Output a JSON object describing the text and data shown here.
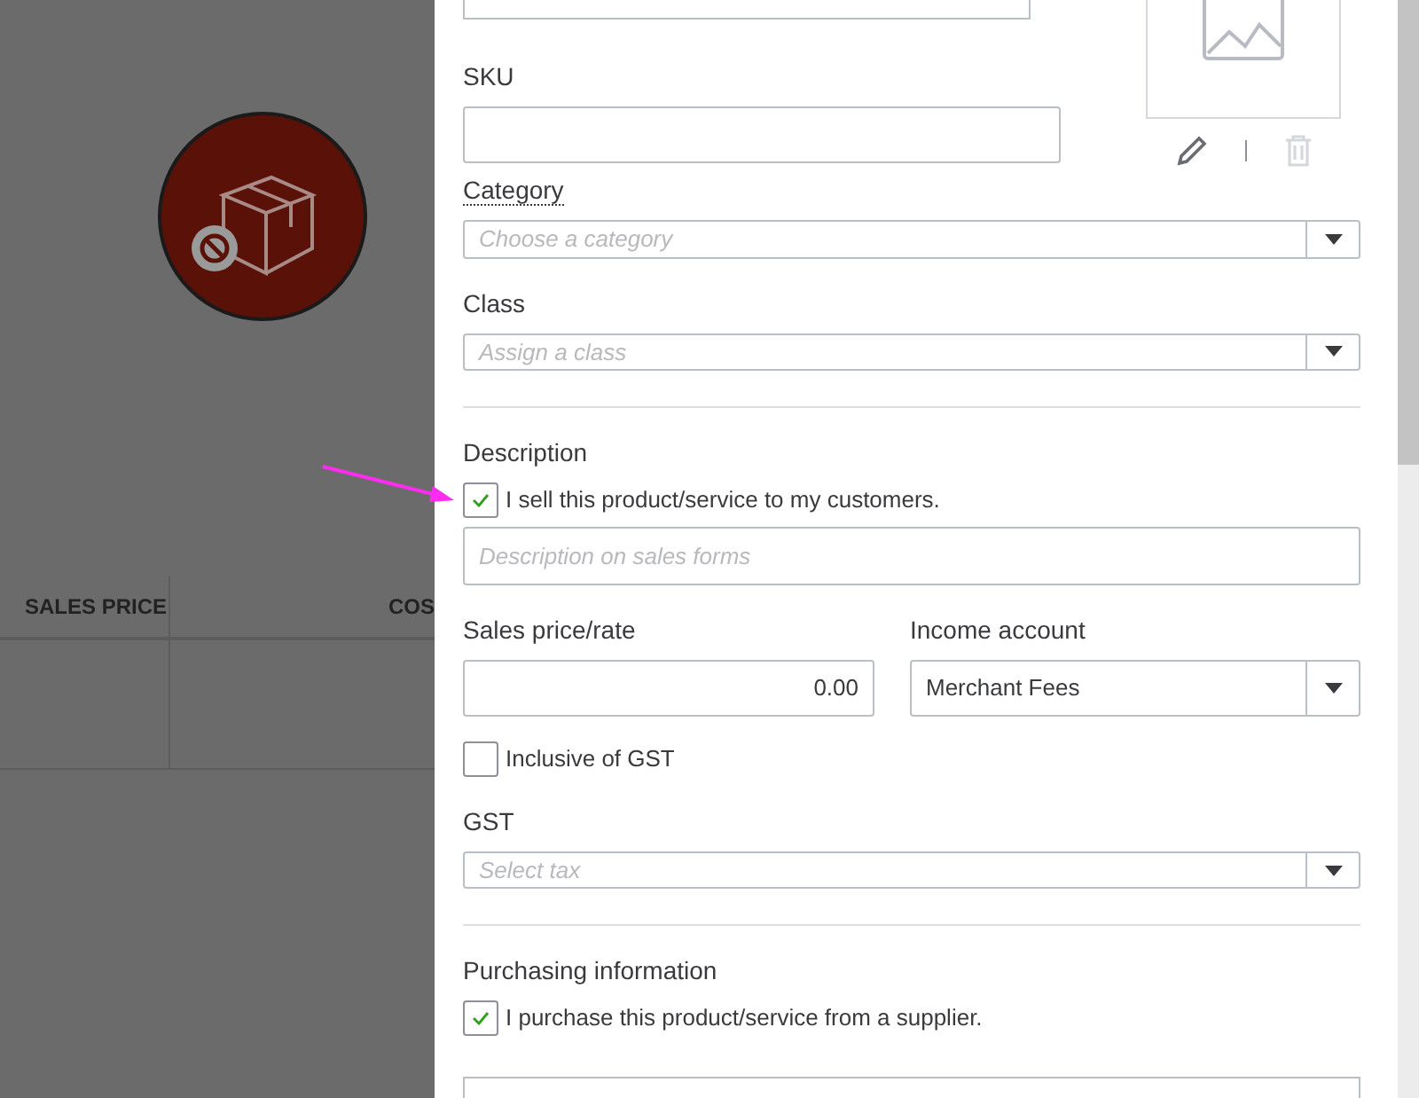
{
  "background": {
    "table_columns": [
      {
        "label": "SALES PRICE"
      },
      {
        "label": "COS"
      }
    ]
  },
  "panel": {
    "sku": {
      "label": "SKU"
    },
    "category": {
      "label": "Category",
      "placeholder": "Choose a category"
    },
    "class": {
      "label": "Class",
      "placeholder": "Assign a class"
    },
    "description": {
      "label": "Description",
      "sell_checkbox": {
        "label": "I sell this product/service to my customers.",
        "checked": true
      },
      "placeholder": "Description on sales forms"
    },
    "sales_price": {
      "label": "Sales price/rate",
      "value": "0.00"
    },
    "income_account": {
      "label": "Income account",
      "value": "Merchant Fees"
    },
    "inclusive_gst": {
      "label": "Inclusive of GST",
      "checked": false
    },
    "gst": {
      "label": "GST",
      "placeholder": "Select tax"
    },
    "purchasing": {
      "label": "Purchasing information",
      "purchase_checkbox": {
        "label": "I purchase this product/service from a supplier.",
        "checked": true
      }
    }
  }
}
